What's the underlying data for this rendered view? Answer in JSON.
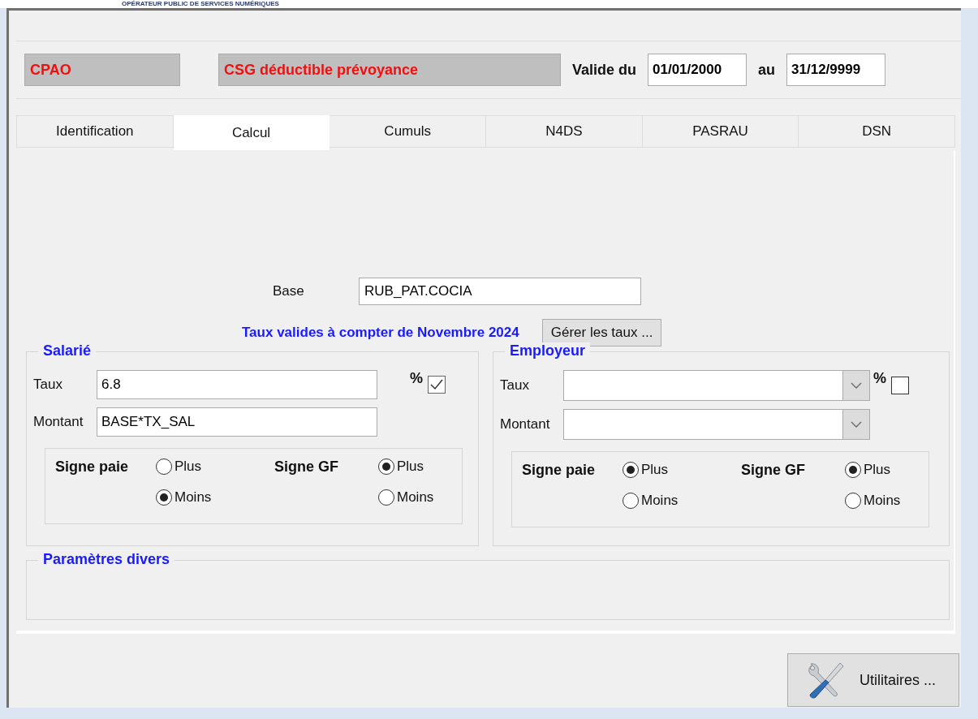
{
  "banner": {
    "text": "OPÉRATEUR PUBLIC DE SERVICES NUMÉRIQUES"
  },
  "header": {
    "code": "CPAO",
    "label": "CSG déductible prévoyance",
    "valid_from_label": "Valide du",
    "valid_from": "01/01/2000",
    "valid_to_label": "au",
    "valid_to": "31/12/9999"
  },
  "tabs": [
    {
      "label": "Identification",
      "selected": false
    },
    {
      "label": "Calcul",
      "selected": true
    },
    {
      "label": "Cumuls",
      "selected": false
    },
    {
      "label": "N4DS",
      "selected": false
    },
    {
      "label": "PASRAU",
      "selected": false
    },
    {
      "label": "DSN",
      "selected": false
    }
  ],
  "base": {
    "label": "Base",
    "value": "RUB_PAT.COCIA"
  },
  "rates_notice": "Taux valides à compter de Novembre 2024",
  "manage_rates_button": "Gérer les taux ...",
  "sections": [
    {
      "title": "Salarié",
      "rate": {
        "label": "Taux",
        "kind": "text",
        "value": "6.8"
      },
      "percent_label": "%",
      "percent_checked": true,
      "amount": {
        "label": "Montant",
        "kind": "text",
        "value": "BASE*TX_SAL"
      },
      "signs": [
        {
          "label": "Signe paie",
          "options": [
            {
              "label": "Plus",
              "selected": false
            },
            {
              "label": "Moins",
              "selected": true
            }
          ]
        },
        {
          "label": "Signe GF",
          "options": [
            {
              "label": "Plus",
              "selected": true
            },
            {
              "label": "Moins",
              "selected": false
            }
          ]
        }
      ]
    },
    {
      "title": "Employeur",
      "rate": {
        "label": "Taux",
        "kind": "combo"
      },
      "percent_label": "%",
      "percent_checked": false,
      "amount": {
        "label": "Montant",
        "kind": "combo"
      },
      "signs": [
        {
          "label": "Signe paie",
          "options": [
            {
              "label": "Plus",
              "selected": true
            },
            {
              "label": "Moins",
              "selected": false
            }
          ]
        },
        {
          "label": "Signe GF",
          "options": [
            {
              "label": "Plus",
              "selected": true
            },
            {
              "label": "Moins",
              "selected": false
            }
          ]
        }
      ]
    }
  ],
  "misc_group": {
    "title": "Paramètres divers"
  },
  "utilities_button": "Utilitaires ..."
}
